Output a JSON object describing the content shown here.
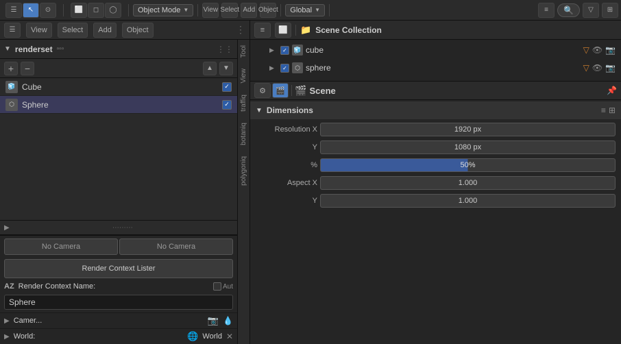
{
  "topbar": {
    "mode": "Object Mode",
    "view": "View",
    "select": "Select",
    "add": "Add",
    "object": "Object",
    "global": "Global"
  },
  "leftPanel": {
    "renderset_title": "renderset",
    "items": [
      {
        "name": "Cube",
        "checked": true
      },
      {
        "name": "Sphere",
        "checked": true,
        "selected": true
      }
    ],
    "camera_btn1": "No Camera",
    "camera_btn2": "No Camera",
    "render_btn": "Render Context Lister",
    "context_name_label": "Render Context Name:",
    "context_name_value": "Sphere",
    "camer_label": "Camer...",
    "world_label": "World:",
    "world_name": "World"
  },
  "sideTabs": {
    "items": [
      "Tool",
      "View",
      "traffiq",
      "botaniq",
      "polygoniq"
    ]
  },
  "outliner": {
    "title": "Scene Collection",
    "items": [
      {
        "name": "cube",
        "has_tri": true
      },
      {
        "name": "sphere",
        "has_tri": true
      }
    ]
  },
  "properties": {
    "scene_label": "Scene",
    "dimensions": {
      "title": "Dimensions",
      "rows": [
        {
          "label": "Resolution X",
          "value": "1920 px"
        },
        {
          "label": "Y",
          "value": "1080 px"
        },
        {
          "label": "%",
          "value": "50%",
          "is_percent": true
        },
        {
          "label": "Aspect X",
          "value": "1.000"
        },
        {
          "label": "Y",
          "value": "1.000"
        }
      ]
    }
  }
}
